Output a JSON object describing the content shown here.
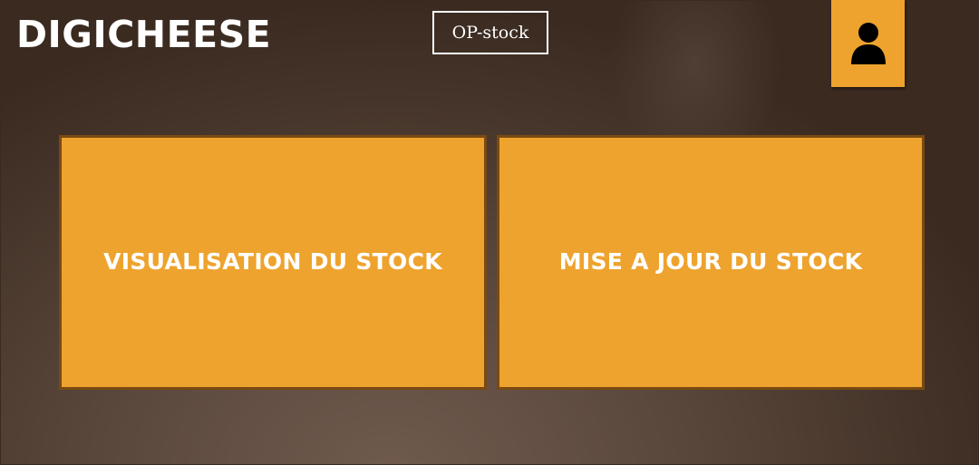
{
  "header": {
    "app_title": "DIGICHEESE",
    "module_badge": "OP-stock",
    "user_icon": "user-icon"
  },
  "main": {
    "tiles": [
      {
        "label": "VISUALISATION DU STOCK"
      },
      {
        "label": "MISE A JOUR DU STOCK"
      }
    ]
  },
  "colors": {
    "accent": "#eea32e",
    "tile_border": "#7a4a12",
    "background": "#4a3a2f",
    "text": "#ffffff"
  }
}
